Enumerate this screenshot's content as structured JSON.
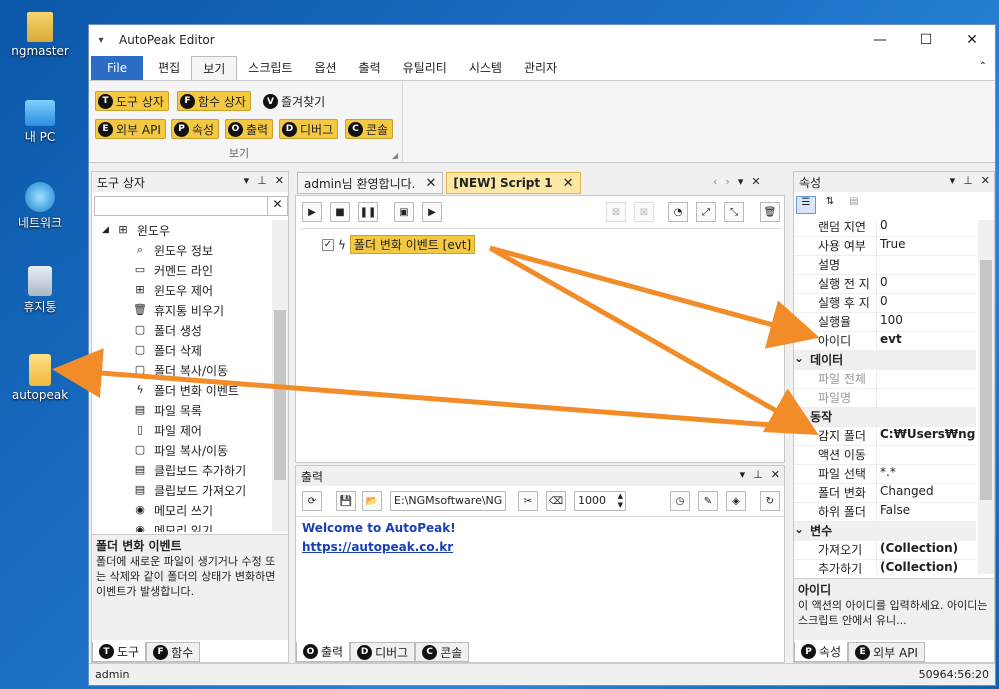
{
  "desktop": {
    "icons": [
      {
        "label": "ngmaster",
        "icon": "user-icon"
      },
      {
        "label": "내 PC",
        "icon": "computer-icon"
      },
      {
        "label": "네트워크",
        "icon": "network-icon"
      },
      {
        "label": "휴지통",
        "icon": "recycle-bin-icon"
      },
      {
        "label": "autopeak",
        "icon": "folder-icon"
      }
    ]
  },
  "window": {
    "title": "AutoPeak Editor",
    "minimize": "—",
    "maximize": "☐",
    "close": "✕"
  },
  "menu": {
    "file": "File",
    "tabs": [
      "편집",
      "보기",
      "스크립트",
      "옵션",
      "출력",
      "유틸리티",
      "시스템",
      "관리자"
    ]
  },
  "ribbon": {
    "group_label": "보기",
    "buttons": [
      {
        "icon": "T",
        "label": "도구 상자"
      },
      {
        "icon": "F",
        "label": "함수 상자"
      },
      {
        "icon": "V",
        "label": "즐겨찾기"
      },
      {
        "icon": "E",
        "label": "외부 API"
      },
      {
        "icon": "P",
        "label": "속성"
      },
      {
        "icon": "O",
        "label": "출력"
      },
      {
        "icon": "D",
        "label": "디버그"
      },
      {
        "icon": "C",
        "label": "콘솔"
      }
    ]
  },
  "toolbox": {
    "title": "도구 상자",
    "root": "윈도우",
    "items": [
      "윈도우 정보",
      "커멘드 라인",
      "윈도우 제어",
      "휴지통 비우기",
      "폴더 생성",
      "폴더 삭제",
      "폴더 복사/이동",
      "폴더 변화 이벤트",
      "파일 목록",
      "파일 제어",
      "파일 복사/이동",
      "클립보드 추가하기",
      "클립보드 가져오기",
      "메모리 쓰기",
      "메모리 읽기"
    ],
    "desc_title": "폴더 변화 이벤트",
    "desc_text": "폴더에 새로운 파일이 생기거나 수정 또는 삭제와 같이 폴더의 상태가 변화하면 이벤트가 발생합니다.",
    "tabs": [
      {
        "icon": "T",
        "label": "도구"
      },
      {
        "icon": "F",
        "label": "함수"
      }
    ]
  },
  "editor": {
    "tabs": [
      {
        "label": "admin님 환영합니다."
      },
      {
        "label": "[NEW] Script 1"
      }
    ],
    "node": "폴더 변화 이벤트 [evt]"
  },
  "output": {
    "title": "출력",
    "path": "E:\\NGMsoftware\\NG",
    "count": "1000",
    "lines": [
      "Welcome to AutoPeak!",
      "https://autopeak.co.kr"
    ],
    "tabs": [
      {
        "icon": "O",
        "label": "출력"
      },
      {
        "icon": "D",
        "label": "디버그"
      },
      {
        "icon": "C",
        "label": "콘솔"
      }
    ]
  },
  "properties": {
    "title": "속성",
    "rows": [
      {
        "k": "랜덤 지연",
        "v": "0"
      },
      {
        "k": "사용 여부",
        "v": "True"
      },
      {
        "k": "설명",
        "v": ""
      },
      {
        "k": "실행 전 지",
        "v": "0"
      },
      {
        "k": "실행 후 지",
        "v": "0"
      },
      {
        "k": "실행율",
        "v": "100"
      },
      {
        "k": "아이디",
        "v": "evt",
        "bold": true
      },
      {
        "cat": "데이터"
      },
      {
        "k": "파일 전체",
        "v": "",
        "dim": true
      },
      {
        "k": "파일명",
        "v": "",
        "dim": true
      },
      {
        "cat": "동작"
      },
      {
        "k": "감지 폴더",
        "v": "C:₩Users₩ngma",
        "bold": true
      },
      {
        "k": "액션 이동",
        "v": ""
      },
      {
        "k": "파일 선택",
        "v": "*.*"
      },
      {
        "k": "폴더 변화",
        "v": "Changed"
      },
      {
        "k": "하위 폴더",
        "v": "False"
      },
      {
        "cat": "변수"
      },
      {
        "k": "가져오기",
        "v": "(Collection)",
        "bold": true
      },
      {
        "k": "추가하기",
        "v": "(Collection)",
        "bold": true
      }
    ],
    "desc_title": "아이디",
    "desc_text": "이 액션의 아이디를 입력하세요. 아이디는 스크립트 안에서 유니...",
    "tabs": [
      {
        "icon": "P",
        "label": "속성"
      },
      {
        "icon": "E",
        "label": "외부 API"
      }
    ]
  },
  "status": {
    "user": "admin",
    "right": "50964:56:20"
  },
  "colors": {
    "accent": "#2b6cc4",
    "button": "#f5c842",
    "arrow": "#f28c28"
  }
}
